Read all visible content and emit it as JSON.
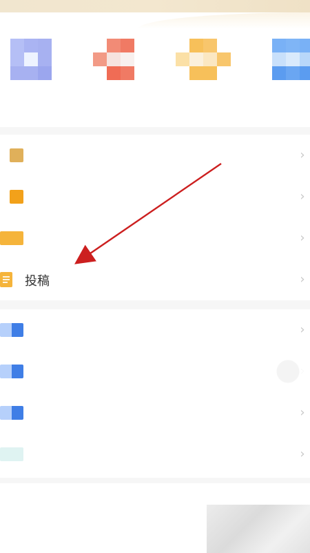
{
  "top_apps": [
    {
      "label": "",
      "icon": "app-icon-1",
      "accent": "#9aa6f2"
    },
    {
      "label": "",
      "icon": "app-icon-2",
      "accent": "#f06c55"
    },
    {
      "label": "",
      "icon": "app-icon-3",
      "accent": "#f7c05a"
    },
    {
      "label": "",
      "icon": "app-icon-4",
      "accent": "#5b9cf0"
    }
  ],
  "sections": {
    "section1": {
      "rows": [
        {
          "icon": "doc-icon",
          "label": "",
          "accent": "#e0b05a"
        },
        {
          "icon": "doc-icon",
          "label": "",
          "accent": "#f2a11a"
        },
        {
          "icon": "doc-icon",
          "label": "",
          "accent": "#f5b43b"
        },
        {
          "icon": "doc-icon",
          "label": "投稿",
          "accent": "#f5b43b"
        }
      ]
    },
    "section2": {
      "rows": [
        {
          "icon": "blue-icon",
          "label": "",
          "accent": "#3f7ee6"
        },
        {
          "icon": "blue-icon",
          "label": "",
          "accent": "#3f7ee6"
        },
        {
          "icon": "blue-icon",
          "label": "",
          "accent": "#3f7ee6"
        },
        {
          "icon": "light-icon",
          "label": "",
          "accent": "#dff3f2"
        }
      ]
    }
  },
  "annotation": {
    "type": "arrow",
    "color": "#cc1f1f",
    "target_label": "投稿"
  },
  "colors": {
    "separator": "#f6f6f6",
    "chevron": "#c8c8c8"
  }
}
